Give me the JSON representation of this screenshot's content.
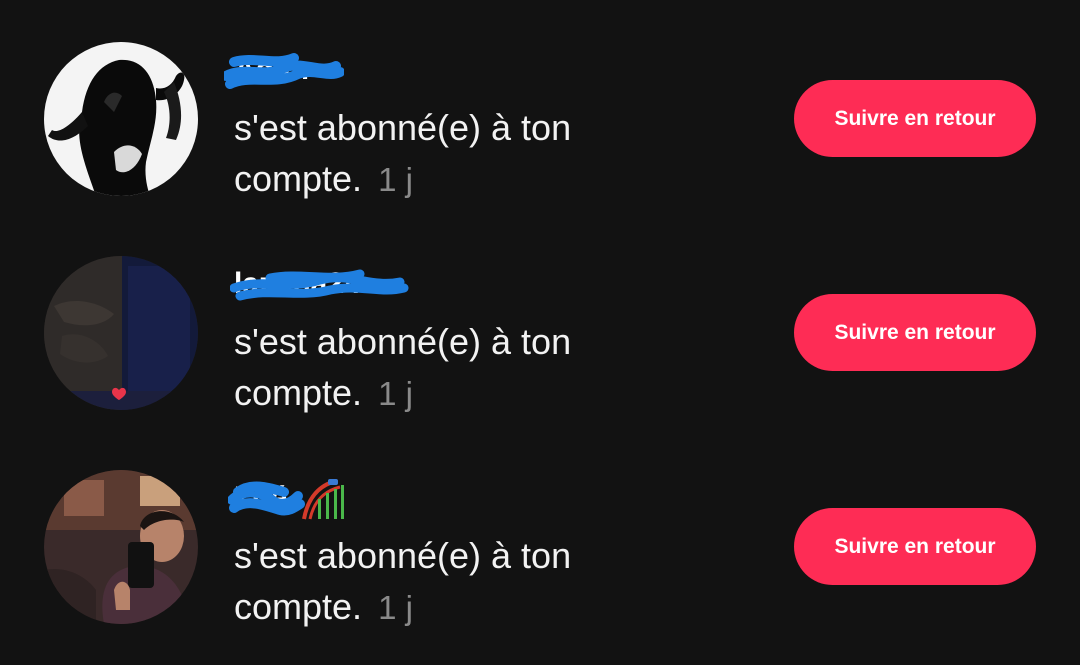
{
  "colors": {
    "background": "#121212",
    "accent": "#fe2c55",
    "text": "#f2f2f2",
    "muted": "#8a8a8a",
    "redaction": "#1f7fe0"
  },
  "notifications": [
    {
      "username": "Adlin",
      "username_redacted": true,
      "message": "s'est abonné(e) à ton compte.",
      "time": "1 j",
      "button_label": "Suivre en retour"
    },
    {
      "username": "lazona24",
      "username_redacted": true,
      "message": "s'est abonné(e) à ton compte.",
      "time": "1 j",
      "button_label": "Suivre en retour"
    },
    {
      "username": "Zoé",
      "username_redacted": true,
      "username_emoji": "roller-coaster-emoji-icon",
      "message": "s'est abonné(e) à ton compte.",
      "time": "1 j",
      "button_label": "Suivre en retour"
    }
  ]
}
